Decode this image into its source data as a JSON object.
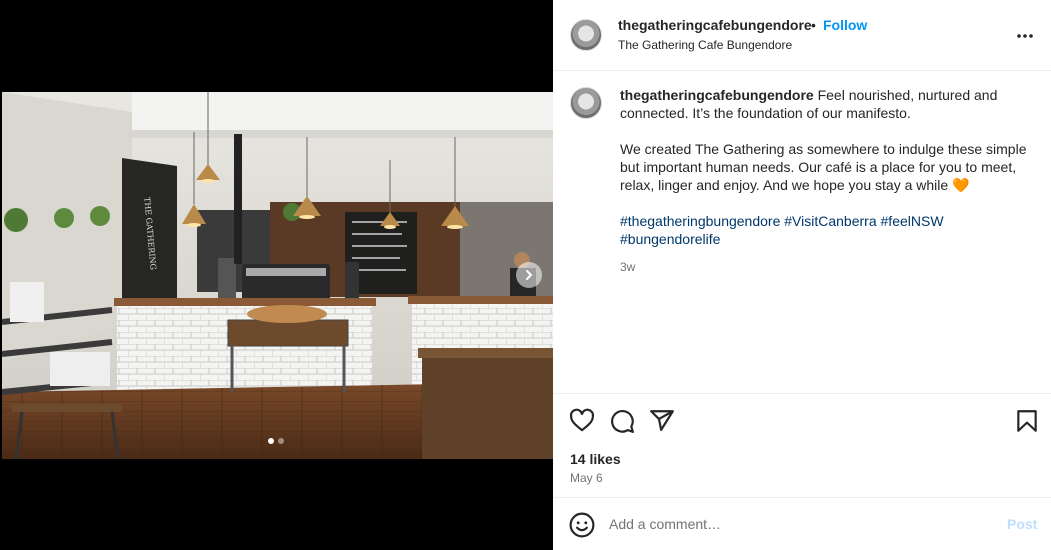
{
  "post": {
    "username": "thegatheringcafebungendore",
    "follow_separator": "•",
    "follow_label": "Follow",
    "location": "The Gathering Cafe Bungendore"
  },
  "caption": {
    "username": "thegatheringcafebungendore",
    "line1": "Feel nourished, nurtured and connected. It’s the foundation of our manifesto.",
    "line2": "We created The Gathering as somewhere to indulge these simple but important human needs. Our café is a place for you to meet, relax, linger and enjoy. And we hope you stay a while 🧡",
    "hashtags": [
      "#thegatheringbungendore",
      "#VisitCanberra",
      "#feelNSW",
      "#bungendorelife"
    ],
    "time": "3w"
  },
  "media": {
    "chalkboard_text": "THE GATHERING",
    "carousel": {
      "count": 2,
      "active": 0
    }
  },
  "engagement": {
    "likes": "14 likes",
    "date": "May 6"
  },
  "comment_box": {
    "placeholder": "Add a comment…",
    "post_label": "Post"
  },
  "icons": {
    "more": "more-options-icon",
    "like": "heart-icon",
    "comment": "comment-icon",
    "share": "share-icon",
    "save": "bookmark-icon",
    "emoji": "emoji-icon",
    "next": "chevron-right-icon"
  },
  "colors": {
    "follow": "#0095f6",
    "hashtag": "#00376b",
    "secondary_text": "#737373",
    "post_disabled": "#c0dffd"
  }
}
